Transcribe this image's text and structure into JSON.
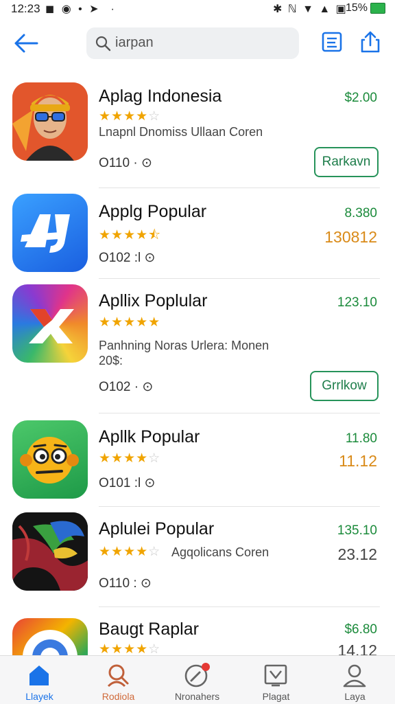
{
  "status_bar": {
    "time": "12:23",
    "battery": "15%"
  },
  "search": {
    "query": "iarpan"
  },
  "apps": [
    {
      "name": "Aplag Indonesia",
      "rating": 4,
      "description": "Lnapnl Dnomiss Ullaan Coren",
      "meta": "O110 · ⊙",
      "price": "$2.00",
      "button": "Rarkavn"
    },
    {
      "name": "Applg Popular",
      "rating": 4.5,
      "meta": "O102 :l ⊙",
      "price": "8.380",
      "secondary": "130812"
    },
    {
      "name": "Apllix Poplular",
      "rating": 5,
      "description": "Panhning Noras Urlera: Monen\n20$:",
      "meta": "O102 · ⊙",
      "price": "123.10",
      "button": "Grrlkow"
    },
    {
      "name": "Apllk Popular",
      "rating": 4,
      "meta": "O101 :l ⊙",
      "price": "11.80",
      "secondary": "11.12"
    },
    {
      "name": "Aplulei Popular",
      "rating": 4,
      "description": "Agqolicans Coren",
      "meta": "O110 : ⊙",
      "price": "135.10",
      "secondary": "23.12"
    },
    {
      "name": "Baugt Raplar",
      "rating": 4,
      "price": "$6.80",
      "secondary": "14.12"
    }
  ],
  "nav": {
    "items": [
      {
        "label": "Llayek",
        "icon": "home-icon",
        "active": true
      },
      {
        "label": "Rodiola",
        "icon": "search-person-icon",
        "active": false
      },
      {
        "label": "Nronahers",
        "icon": "compass-icon",
        "active": false
      },
      {
        "label": "Plagat",
        "icon": "download-icon",
        "active": false
      },
      {
        "label": "Laya",
        "icon": "profile-icon",
        "active": false
      }
    ]
  },
  "colors": {
    "accent": "#1a73e8",
    "price_green": "#1a8a3a",
    "star": "#f0a400",
    "orange": "#d98a18"
  }
}
